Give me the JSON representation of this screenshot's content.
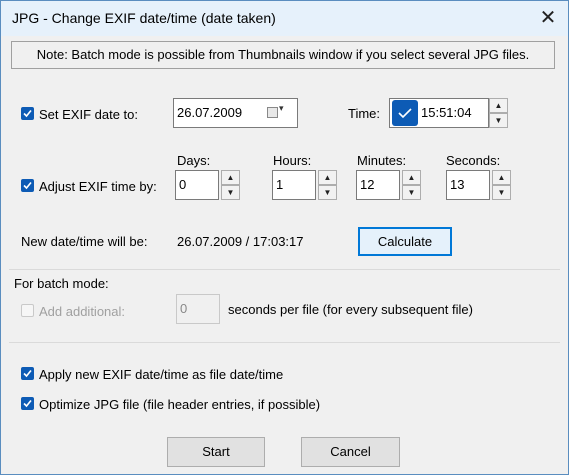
{
  "window": {
    "title": "JPG - Change EXIF date/time (date taken)",
    "close_glyph": "✕"
  },
  "note": "Note: Batch mode is possible from Thumbnails window if you select several JPG files.",
  "set_date": {
    "label": "Set EXIF date to:",
    "checked": true,
    "date_value": "26.07.2009",
    "time_label": "Time:",
    "time_value": "15:51:04",
    "calendar_icon": "calendar-icon"
  },
  "adjust": {
    "label": "Adjust EXIF time by:",
    "checked": true,
    "days_label": "Days:",
    "days_value": "0",
    "hours_label": "Hours:",
    "hours_value": "1",
    "minutes_label": "Minutes:",
    "minutes_value": "12",
    "seconds_label": "Seconds:",
    "seconds_value": "13"
  },
  "result": {
    "label": "New date/time will be:",
    "value": "26.07.2009 / 17:03:17",
    "calculate_label": "Calculate"
  },
  "batch": {
    "heading": "For batch mode:",
    "add_label": "Add additional:",
    "add_value": "0",
    "suffix": "seconds per file (for every subsequent file)"
  },
  "options": {
    "apply_label": "Apply new EXIF date/time as file date/time",
    "optimize_label": "Optimize JPG file (file header entries, if possible)"
  },
  "buttons": {
    "start": "Start",
    "cancel": "Cancel"
  },
  "colors": {
    "accent": "#0d5bb5",
    "title_bar": "#e6f1fb"
  }
}
